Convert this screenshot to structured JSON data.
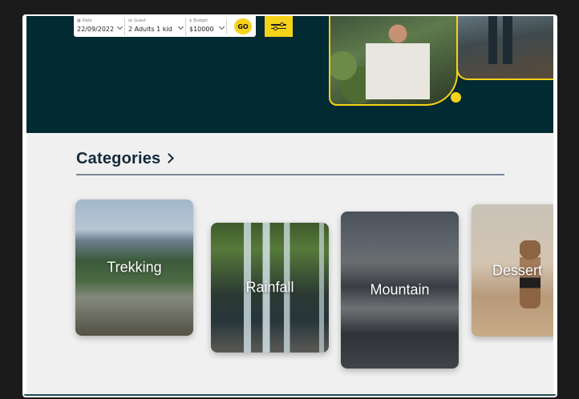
{
  "booking": {
    "date": {
      "label": "Date",
      "value": "22/09/2022",
      "icon": "calendar-icon"
    },
    "guest": {
      "label": "Guest",
      "value": "2 Adults 1 kid",
      "icon": "people-icon"
    },
    "budget": {
      "label": "Budget",
      "value": "$10000",
      "icon": "dollar-icon"
    },
    "go_label": "GO",
    "filter_icon": "sliders-icon"
  },
  "colors": {
    "hero_bg": "#022a33",
    "accent": "#f7d21a",
    "heading": "#142a3c",
    "page_bg": "#f0f0f0"
  },
  "categories": {
    "title": "Categories",
    "items": [
      {
        "label": "Trekking"
      },
      {
        "label": "Rainfall"
      },
      {
        "label": "Mountain"
      },
      {
        "label": "Dessert"
      }
    ]
  }
}
